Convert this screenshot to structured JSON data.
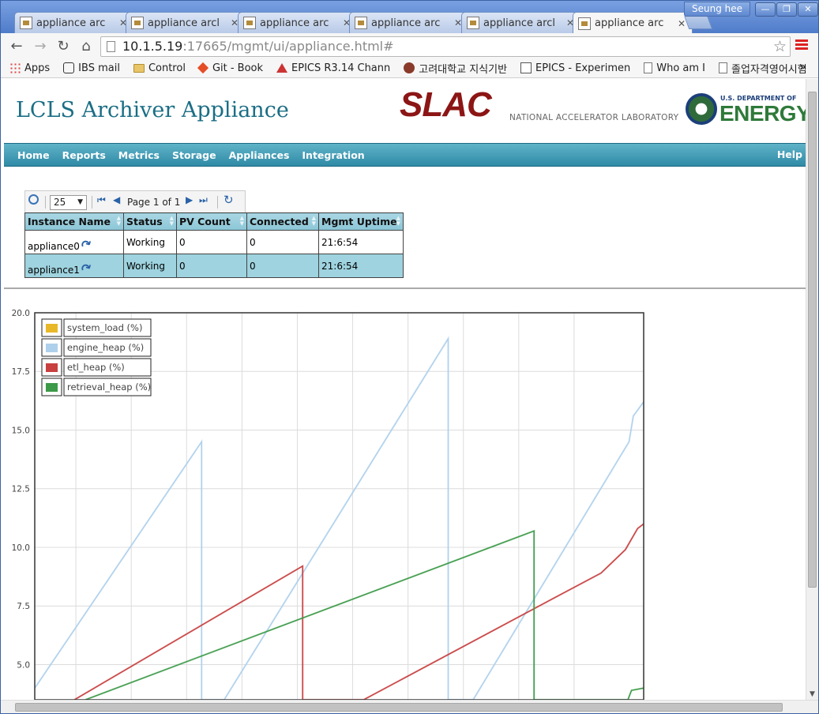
{
  "browser": {
    "tabs": [
      {
        "title": "appliance arc"
      },
      {
        "title": "appliance arcl"
      },
      {
        "title": "appliance arc"
      },
      {
        "title": "appliance arc"
      },
      {
        "title": "appliance arcl"
      },
      {
        "title": "appliance arc"
      }
    ],
    "profile_name": "Seung hee",
    "url_host": "10.1.5.19",
    "url_rest": ":17665/mgmt/ui/appliance.html#",
    "bookmarks": [
      "Apps",
      "IBS mail",
      "Control",
      "Git - Book",
      "EPICS R3.14 Chann",
      "고려대학교 지식기반",
      "EPICS - Experimen",
      "Who am I",
      "졸업자격영어시험"
    ],
    "bookmarks_more": "»"
  },
  "header": {
    "title": "LCLS Archiver Appliance",
    "slac_word": "SLAC",
    "slac_sub": "NATIONAL ACCELERATOR LABORATORY",
    "doe_top": "U.S. DEPARTMENT OF",
    "doe_word": "ENERGY"
  },
  "nav": {
    "items": [
      "Home",
      "Reports",
      "Metrics",
      "Storage",
      "Appliances",
      "Integration"
    ],
    "help": "Help"
  },
  "pager": {
    "page_size": "25",
    "page_text": "Page 1 of 1"
  },
  "table": {
    "columns": [
      "Instance Name",
      "Status",
      "PV Count",
      "Connected",
      "Mgmt Uptime"
    ],
    "rows": [
      [
        "appliance0",
        "Working",
        "0",
        "0",
        "21:6:54"
      ],
      [
        "appliance1",
        "Working",
        "0",
        "0",
        "21:6:54"
      ]
    ]
  },
  "chart_data": {
    "type": "line",
    "ylim": [
      3.5,
      20.0
    ],
    "yticks": [
      5.0,
      7.5,
      10.0,
      12.5,
      15.0,
      17.5,
      20.0
    ],
    "ytick_labels": [
      "5.0",
      "7.5",
      "10.0",
      "12.5",
      "15.0",
      "17.5",
      "20.0"
    ],
    "xlim": [
      0,
      100
    ],
    "grid": true,
    "legend_placement": "top-left",
    "series": [
      {
        "name": "system_load (%)",
        "color": "#e8b828",
        "x": [],
        "y": []
      },
      {
        "name": "engine_heap (%)",
        "color": "#afd0ec",
        "x": [
          0,
          27.4,
          27.4,
          31.1,
          67.9,
          67.9,
          72.0,
          97.6,
          98.3,
          100
        ],
        "y": [
          4.0,
          14.5,
          3.5,
          3.5,
          18.9,
          3.5,
          3.5,
          14.5,
          15.6,
          16.2
        ]
      },
      {
        "name": "etl_heap (%)",
        "color": "#c84040",
        "x": [
          6.5,
          44.0,
          44.0,
          54.0,
          85.0,
          93.0,
          97.0,
          99.0,
          100
        ],
        "y": [
          3.5,
          9.2,
          3.5,
          3.5,
          7.8,
          8.9,
          9.9,
          10.8,
          11.0
        ]
      },
      {
        "name": "retrieval_heap (%)",
        "color": "#3c9a48",
        "x": [
          8.3,
          82.0,
          82.0,
          97.4,
          98.0,
          100
        ],
        "y": [
          3.5,
          10.7,
          3.5,
          3.5,
          3.9,
          4.0
        ]
      }
    ]
  }
}
